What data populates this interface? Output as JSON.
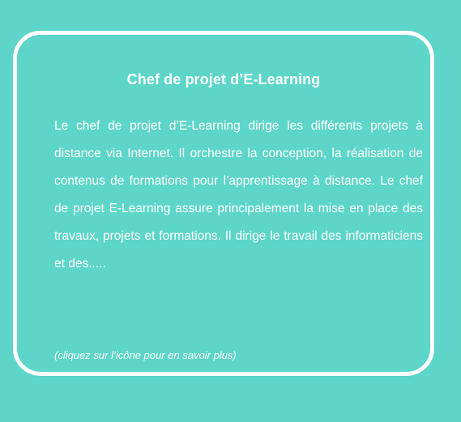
{
  "card": {
    "title": "Chef de projet d’E-Learning",
    "description": "Le chef de projet d’E-Learning dirige les différents projets à distance via Internet.  Il orchestre la conception, la réalisation de contenus de formations pour l’apprentissage à distance. Le chef de projet E-Learning assure principalement la mise en place des travaux, projets et formations. Il dirige le travail des informaticiens et des.....",
    "hint": "(cliquez sur l’icône pour en savoir plus)"
  },
  "colors": {
    "background": "#5dd5c9",
    "border": "#ffffff",
    "text": "#ffffff"
  }
}
